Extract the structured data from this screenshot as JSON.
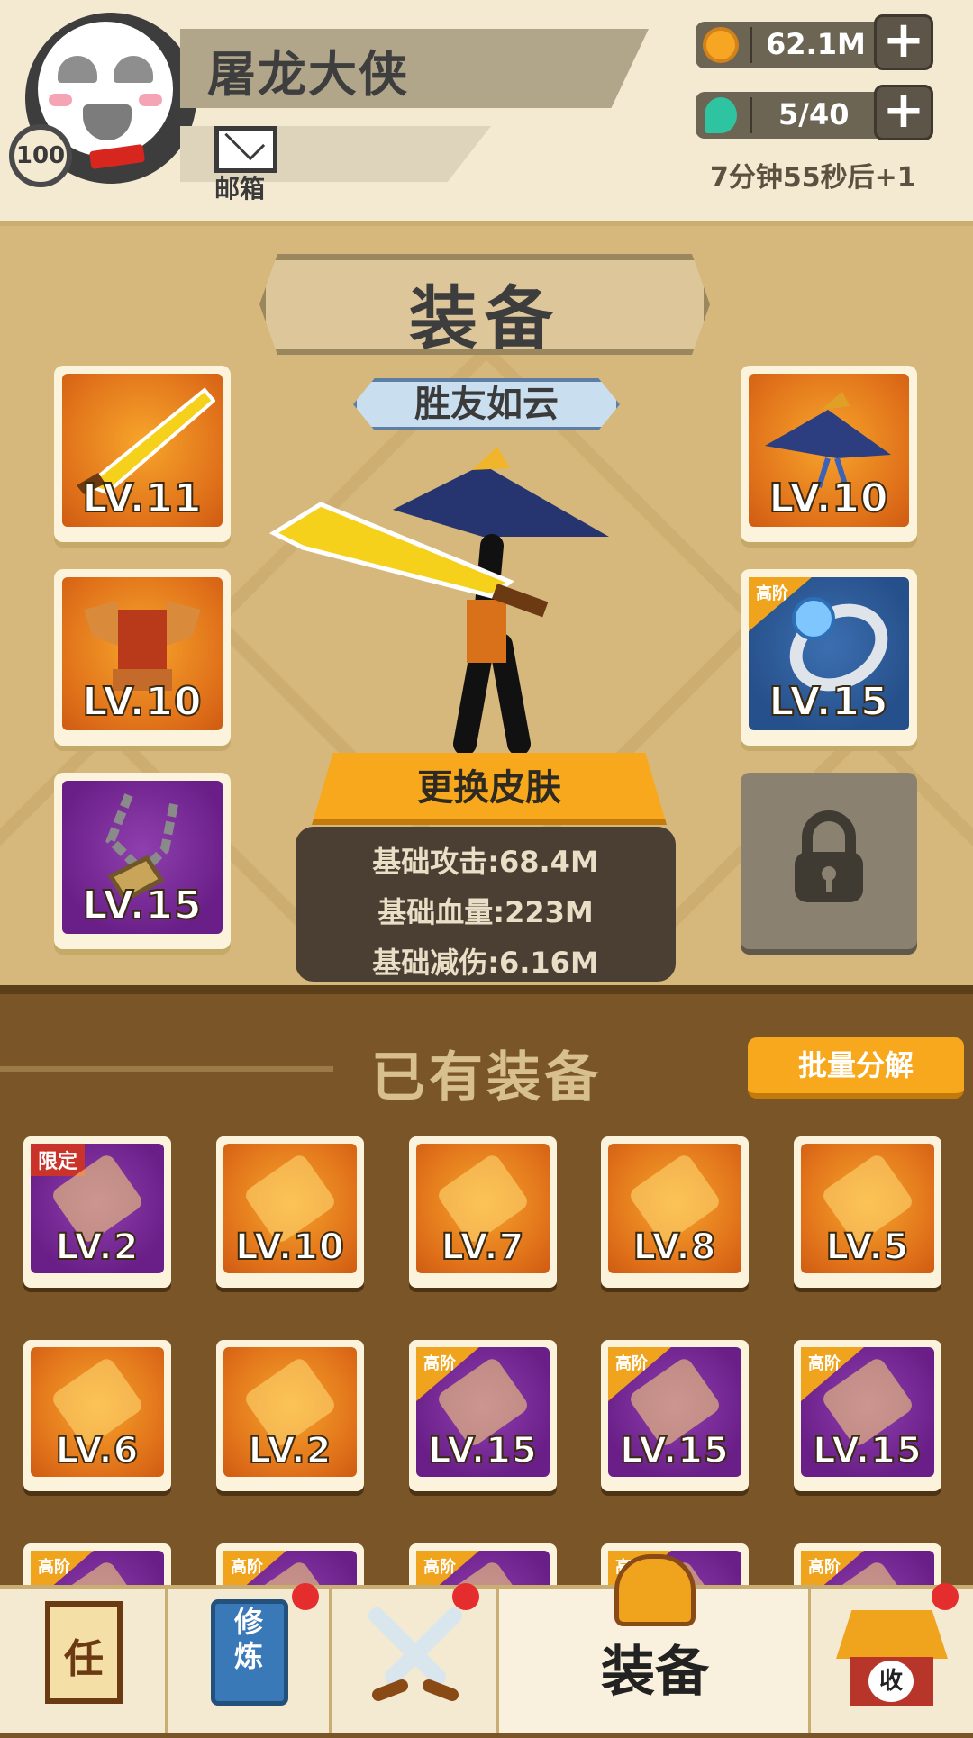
{
  "player": {
    "name": "屠龙大侠",
    "level": "100",
    "mail_label": "邮箱"
  },
  "resources": {
    "gold": "62.1M",
    "energy": "5/40",
    "timer": "7分钟55秒后+1"
  },
  "title": "装备",
  "skin": {
    "name": "胜友如云",
    "change_label": "更换皮肤"
  },
  "stats": {
    "attack": "基础攻击:68.4M",
    "hp": "基础血量:223M",
    "reduction": "基础减伤:6.16M"
  },
  "equipped": {
    "left": [
      {
        "name": "sword",
        "level": "LV.11",
        "color": "orange"
      },
      {
        "name": "armor",
        "level": "LV.10",
        "color": "orange"
      },
      {
        "name": "necklace",
        "level": "LV.15",
        "color": "purple"
      }
    ],
    "right": [
      {
        "name": "hat",
        "level": "LV.10",
        "color": "orange"
      },
      {
        "name": "ring",
        "level": "LV.15",
        "color": "blue",
        "tag": "高阶"
      },
      {
        "name": "locked",
        "level": "",
        "color": "grey"
      }
    ]
  },
  "owned": {
    "title": "已有装备",
    "bulk_label": "批量分解",
    "items": [
      {
        "name": "gourd",
        "level": "LV.2",
        "color": "purple",
        "tag": "限定"
      },
      {
        "name": "staff",
        "level": "LV.10",
        "color": "orange"
      },
      {
        "name": "mace",
        "level": "LV.7",
        "color": "orange"
      },
      {
        "name": "spear",
        "level": "LV.8",
        "color": "orange"
      },
      {
        "name": "sword",
        "level": "LV.5",
        "color": "orange"
      },
      {
        "name": "key",
        "level": "LV.6",
        "color": "orange"
      },
      {
        "name": "robe",
        "level": "LV.2",
        "color": "orange"
      },
      {
        "name": "sword",
        "level": "LV.15",
        "color": "purple",
        "tag": "高阶"
      },
      {
        "name": "broadsword",
        "level": "LV.15",
        "color": "purple",
        "tag": "高阶"
      },
      {
        "name": "broadsword",
        "level": "LV.15",
        "color": "purple",
        "tag": "高阶"
      },
      {
        "name": "item",
        "level": "",
        "color": "purple",
        "tag": "高阶"
      },
      {
        "name": "item",
        "level": "",
        "color": "purple",
        "tag": "高阶"
      },
      {
        "name": "item",
        "level": "",
        "color": "purple",
        "tag": "高阶"
      },
      {
        "name": "item",
        "level": "",
        "color": "purple",
        "tag": "高阶"
      },
      {
        "name": "item",
        "level": "",
        "color": "purple",
        "tag": "高阶"
      }
    ]
  },
  "nav": {
    "task": "任",
    "cultivate": "修\n炼",
    "equip_label": "装备",
    "collect": "收"
  }
}
